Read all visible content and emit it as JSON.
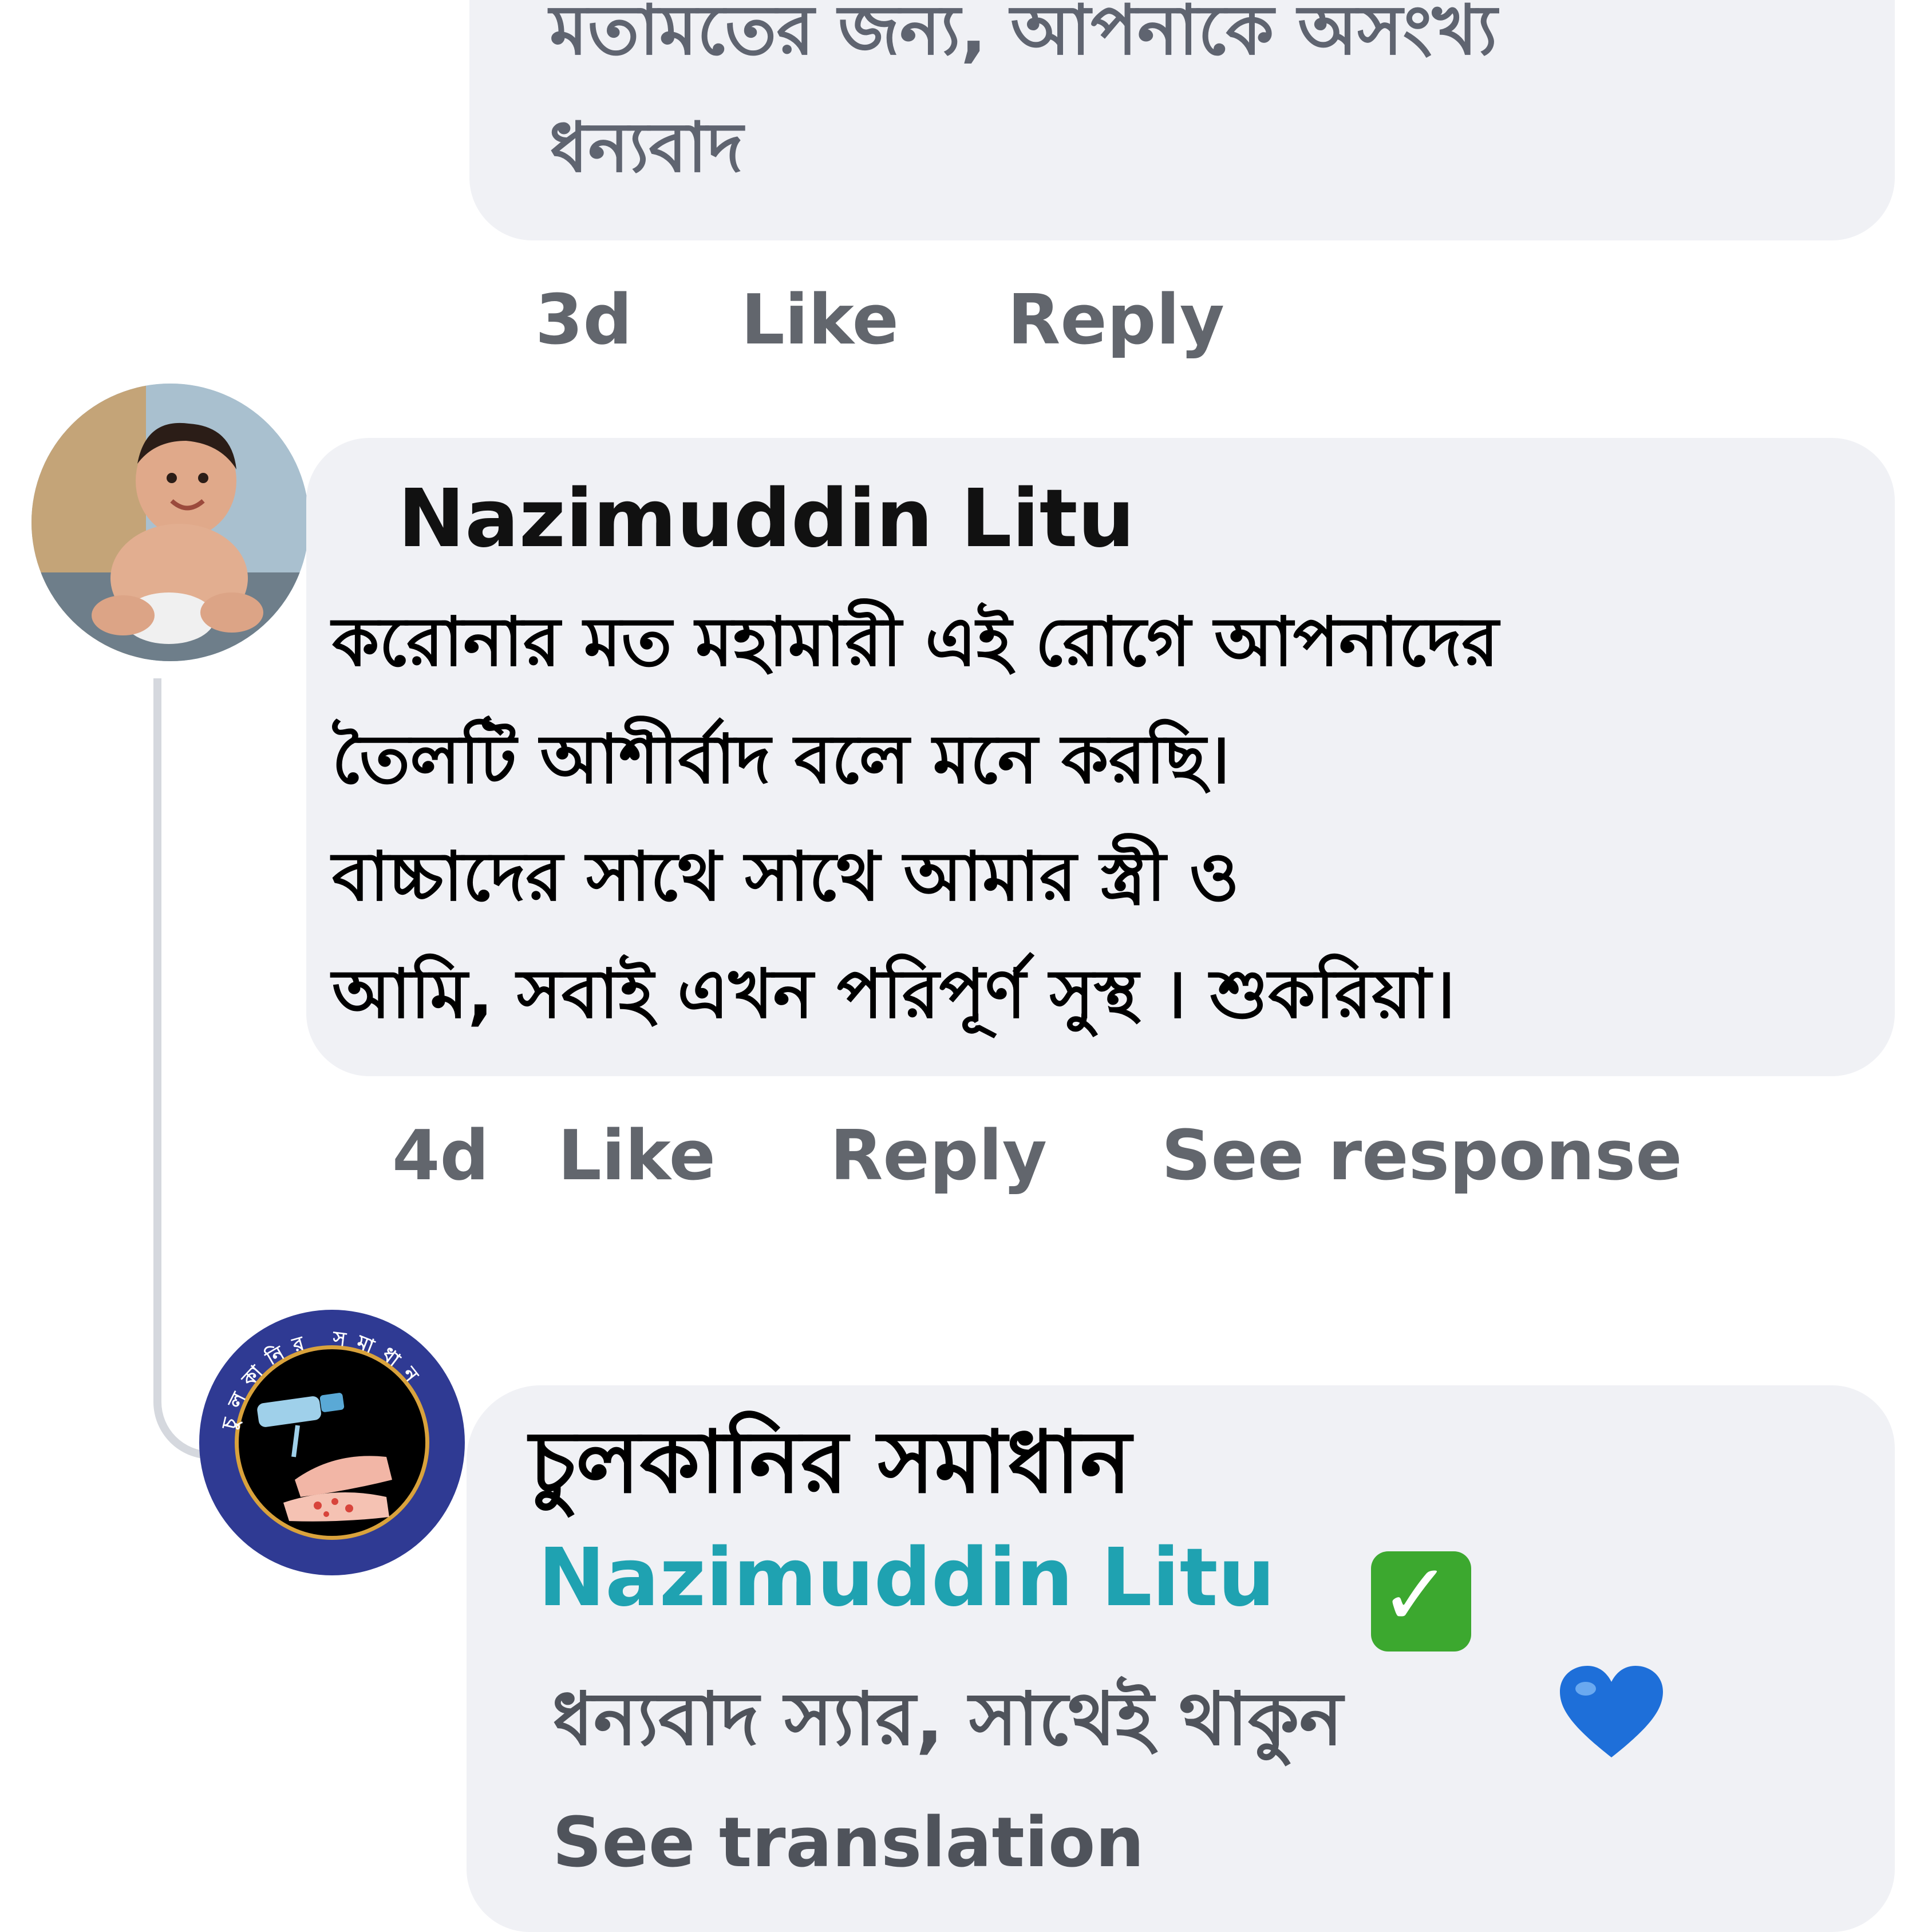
{
  "comments": [
    {
      "text_lines": [
        "মতামতের জন্য, আপনাকে অসংখ্য",
        "ধন্যবাদ"
      ],
      "time": "3d",
      "actions": {
        "like": "Like",
        "reply": "Reply"
      }
    },
    {
      "author": "Nazimuddin Litu",
      "text_lines": [
        "করোনার মত মহামারী এই রোগে আপনাদের",
        "তৈলটি আশীর্বাদ বলে মনে করছি।",
        "বাচ্চাদের সাথে সাথে আমার স্ত্রী ও",
        "আমি, সবাই এখন পরিপূর্ণ সুস্থ । শুকরিয়া।"
      ],
      "time": "4d",
      "actions": {
        "like": "Like",
        "reply": "Reply",
        "see_response": "See response"
      }
    }
  ],
  "reply": {
    "author": "চুলকানির সমাধান",
    "mention": "Nazimuddin Litu",
    "mention_badge_icon": "check-mark-button-icon",
    "text": "ধন্যবাদ স্যার, সাথেই থাকুন",
    "emoji_icon": "blue-heart-icon",
    "see_translation": "See translation"
  },
  "logo": {
    "ring_text": "চুলকানির সমাধান"
  },
  "colors": {
    "bubble_bg": "#f0f1f5",
    "mention": "#1fa2b1",
    "meta_text": "#62666d",
    "logo_ring": "#2f3a93",
    "heart": "#1e6fd9",
    "check": "#3ca82f"
  }
}
